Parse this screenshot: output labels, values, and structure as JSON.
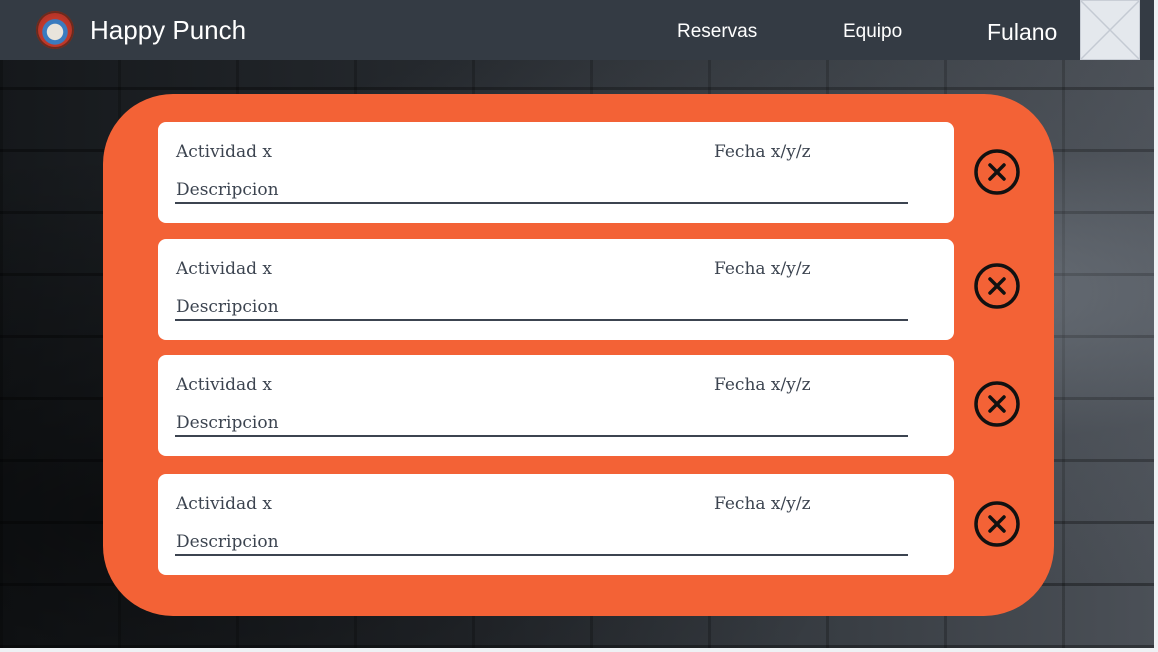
{
  "navbar": {
    "brand": "Happy Punch",
    "links": [
      {
        "label": "Reservas"
      },
      {
        "label": "Equipo"
      }
    ],
    "user_name": "Fulano"
  },
  "bookings": [
    {
      "activity": "Actividad x",
      "date": "Fecha x/y/z",
      "description": "Descripcion"
    },
    {
      "activity": "Actividad x",
      "date": "Fecha x/y/z",
      "description": "Descripcion"
    },
    {
      "activity": "Actividad x",
      "date": "Fecha x/y/z",
      "description": "Descripcion"
    },
    {
      "activity": "Actividad x",
      "date": "Fecha x/y/z",
      "description": "Descripcion"
    }
  ],
  "icons": {
    "remove": "close-circle-icon",
    "avatar": "image-placeholder-icon",
    "logo": "happy-punch-logo"
  },
  "colors": {
    "navbar": "#343b44",
    "panel": "#f36236",
    "card": "#ffffff",
    "text": "#3c4450"
  }
}
